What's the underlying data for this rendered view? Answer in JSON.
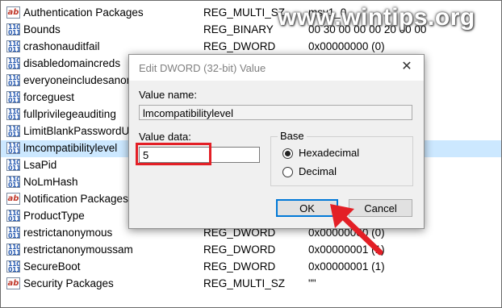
{
  "watermark": "www.wintips.org",
  "registry": {
    "rows": [
      {
        "name": "Authentication Packages",
        "type": "REG_MULTI_SZ",
        "data": "msv1_0",
        "icon": "string-value-icon"
      },
      {
        "name": "Bounds",
        "type": "REG_BINARY",
        "data": "00 30 00 00 00 20 00 00",
        "icon": "binary-value-icon"
      },
      {
        "name": "crashonauditfail",
        "type": "REG_DWORD",
        "data": "0x00000000 (0)",
        "icon": "binary-value-icon"
      },
      {
        "name": "disabledomaincreds",
        "type": "",
        "data": "",
        "icon": "binary-value-icon"
      },
      {
        "name": "everyoneincludesanonymous",
        "type": "",
        "data": "",
        "icon": "binary-value-icon"
      },
      {
        "name": "forceguest",
        "type": "",
        "data": "",
        "icon": "binary-value-icon"
      },
      {
        "name": "fullprivilegeauditing",
        "type": "",
        "data": "",
        "icon": "binary-value-icon"
      },
      {
        "name": "LimitBlankPasswordUse",
        "type": "",
        "data": "",
        "icon": "binary-value-icon"
      },
      {
        "name": "lmcompatibilitylevel",
        "type": "",
        "data": "",
        "icon": "binary-value-icon",
        "selected": true
      },
      {
        "name": "LsaPid",
        "type": "",
        "data": "",
        "icon": "binary-value-icon"
      },
      {
        "name": "NoLmHash",
        "type": "",
        "data": "",
        "icon": "binary-value-icon"
      },
      {
        "name": "Notification Packages",
        "type": "",
        "data": "",
        "icon": "string-value-icon"
      },
      {
        "name": "ProductType",
        "type": "",
        "data": "",
        "icon": "binary-value-icon"
      },
      {
        "name": "restrictanonymous",
        "type": "REG_DWORD",
        "data": "0x00000000 (0)",
        "icon": "binary-value-icon"
      },
      {
        "name": "restrictanonymoussam",
        "type": "REG_DWORD",
        "data": "0x00000001 (1)",
        "icon": "binary-value-icon"
      },
      {
        "name": "SecureBoot",
        "type": "REG_DWORD",
        "data": "0x00000001 (1)",
        "icon": "binary-value-icon"
      },
      {
        "name": "Security Packages",
        "type": "REG_MULTI_SZ",
        "data": "\"\"",
        "icon": "string-value-icon"
      }
    ]
  },
  "icons": {
    "binary_glyph": "110\n011",
    "string_glyph": "ab"
  },
  "dialog": {
    "title": "Edit DWORD (32-bit) Value",
    "close_glyph": "✕",
    "value_name_label": "Value name:",
    "value_name": "lmcompatibilitylevel",
    "value_data_label": "Value data:",
    "value_data": "5",
    "base_label": "Base",
    "base_options": [
      {
        "label": "Hexadecimal",
        "selected": true
      },
      {
        "label": "Decimal",
        "selected": false
      }
    ],
    "ok_label": "OK",
    "cancel_label": "Cancel"
  },
  "colors": {
    "highlight": "#e31f26",
    "selection": "#cce8ff",
    "accent": "#0078d7"
  }
}
